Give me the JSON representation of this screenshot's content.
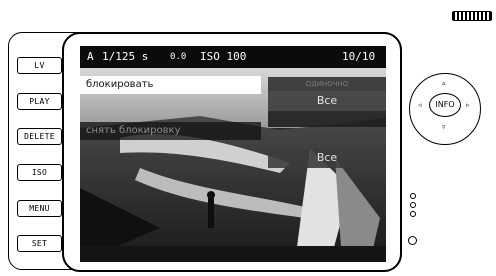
{
  "hardware": {
    "side_buttons": [
      "LV",
      "PLAY",
      "DELETE",
      "ISO",
      "MENU",
      "SET"
    ],
    "dial_center_label": "INFO"
  },
  "status_bar": {
    "mode": "A",
    "shutter": "1/125 s",
    "ev": "0.0",
    "iso": "ISO 100",
    "frame": "10/10"
  },
  "menu": {
    "items": [
      {
        "label": "блокировать",
        "state": "highlighted"
      },
      {
        "label": "снять блокировку",
        "state": "inactive"
      }
    ],
    "right_panel": {
      "header": "ОДИНОЧНО",
      "values": [
        "Все",
        "Все"
      ]
    }
  }
}
